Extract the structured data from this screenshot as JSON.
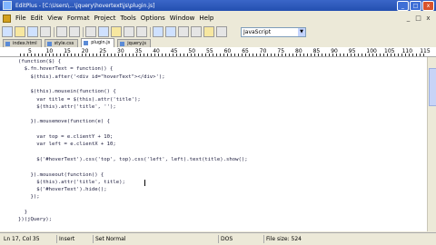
{
  "window": {
    "title": "EditPlus - [C:\\Users\\...\\jquery\\hovertext\\js\\plugin.js]",
    "controls": [
      "_",
      "□",
      "x"
    ]
  },
  "menubar": {
    "items": [
      "File",
      "Edit",
      "View",
      "Format",
      "Project",
      "Tools",
      "Options",
      "Window",
      "Help"
    ],
    "right_controls": [
      "_",
      "□",
      "x"
    ]
  },
  "toolbar": {
    "language": "JavaScript"
  },
  "tabs": [
    {
      "label": "index.html",
      "active": false
    },
    {
      "label": "style.css",
      "active": false
    },
    {
      "label": "plugin.js",
      "active": true
    },
    {
      "label": "jquery.js",
      "active": false
    }
  ],
  "ruler": {
    "marks": [
      "5",
      "10",
      "15",
      "20",
      "25",
      "30",
      "35",
      "40",
      "45",
      "50",
      "55",
      "60",
      "65",
      "70",
      "75",
      "80",
      "85",
      "90",
      "95",
      "100",
      "105",
      "110",
      "115"
    ]
  },
  "code": {
    "lines": [
      "(function($) {",
      "  $.fn.hoverText = function() {",
      "    $(this).after('<div id=\"hoverText\"></div>');",
      "",
      "    $(this).mousein(function() {",
      "      var title = $(this).attr('title');",
      "      $(this).attr('title', '');",
      "",
      "    }).mousemove(function(e) {",
      "",
      "      var top = e.clientY + 10;",
      "      var left = e.clientX + 10;",
      "",
      "      $('#hoverText').css('top', top).css('left', left).text(title).show();",
      "",
      "    }).mouseout(function() {",
      "      $(this).attr('title', title);",
      "      $('#hoverText').hide();",
      "    });",
      "",
      "  }",
      "})(jQuery);"
    ]
  },
  "status": {
    "position": "Ln 17, Col 35",
    "mode1": "Insert",
    "mode2": "Set Normal",
    "encoding": "DOS",
    "size": "File size: 524"
  }
}
